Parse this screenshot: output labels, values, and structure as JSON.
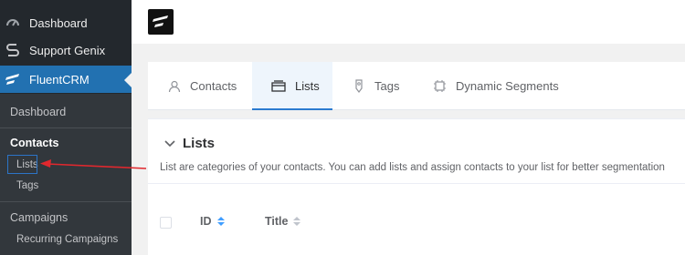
{
  "sidebar": {
    "top_items": [
      {
        "label": "Dashboard",
        "icon": "gauge-icon"
      },
      {
        "label": "Support Genix",
        "icon": "support-genix-icon"
      },
      {
        "label": "FluentCRM",
        "icon": "fluentcrm-logo-icon"
      }
    ],
    "submenu": {
      "dashboard": "Dashboard",
      "contacts": "Contacts",
      "lists": "Lists",
      "tags": "Tags",
      "campaigns": "Campaigns",
      "recurring": "Recurring Campaigns"
    }
  },
  "tabs": [
    {
      "label": "Contacts",
      "icon": "user-icon",
      "active": false
    },
    {
      "label": "Lists",
      "icon": "lists-icon",
      "active": true
    },
    {
      "label": "Tags",
      "icon": "tag-icon",
      "active": false
    },
    {
      "label": "Dynamic Segments",
      "icon": "segments-icon",
      "active": false
    }
  ],
  "panel": {
    "title": "Lists",
    "description": "List are categories of your contacts. You can add lists and assign contacts to your list for better segmentation",
    "columns": [
      {
        "label": "ID",
        "sorted": true
      },
      {
        "label": "Title",
        "sorted": false
      }
    ]
  },
  "colors": {
    "sidebar_bg": "#23282d",
    "submenu_bg": "#32373c",
    "active_menu": "#2271b1",
    "accent": "#2b7bd0",
    "annotation": "#e0282e"
  }
}
